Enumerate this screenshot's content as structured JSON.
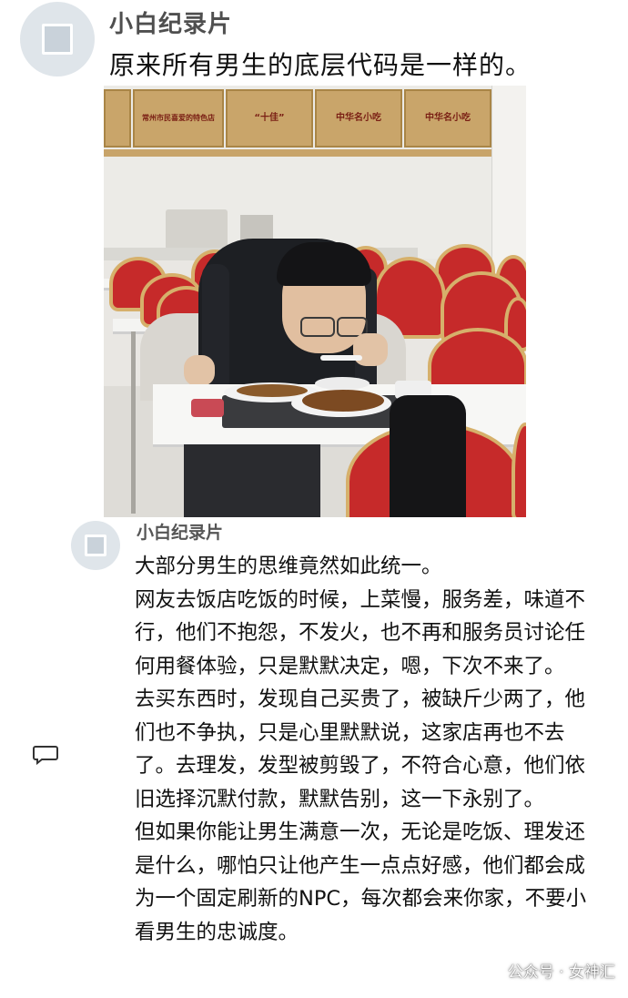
{
  "post1": {
    "author": "小白纪录片",
    "caption": "原来所有男生的底层代码是一样的。",
    "photo": {
      "plaques": [
        {
          "lines": [
            "",
            ""
          ]
        },
        {
          "lines": [
            "常州市民喜爱的特色店",
            ""
          ]
        },
        {
          "lines": [
            "",
            "“十佳”"
          ]
        },
        {
          "lines": [
            "中华名小吃",
            ""
          ]
        },
        {
          "lines": [
            "中华名小吃",
            ""
          ]
        }
      ]
    }
  },
  "post2": {
    "author": "小白纪录片",
    "paragraphs": [
      "大部分男生的思维竟然如此统一。",
      "网友去饭店吃饭的时候，上菜慢，服务差，味道不行，他们不抱怨，不发火，也不再和服务员讨论任何用餐体验，只是默默决定，嗯，下次不来了。",
      "去买东西时，发现自己买贵了，被缺斤少两了，他们也不争执，只是心里默默说，这家店再也不去了。去理发，发型被剪毁了，不符合心意，他们依旧选择沉默付款，默默告别，这一下永别了。",
      "但如果你能让男生满意一次，无论是吃饭、理发还是什么，哪怕只让他产生一点点好感，他们都会成为一个固定刷新的NPC，每次都会来你家，不要小看男生的忠诚度。"
    ]
  },
  "watermark": {
    "text": "公众号 · 女神汇"
  },
  "icons": {
    "avatar1": "avatar-icon",
    "avatar2": "avatar-icon",
    "comment": "comment-icon"
  },
  "colors": {
    "chair_red": "#c62a2a",
    "plaque_gold": "#c9a56a"
  }
}
